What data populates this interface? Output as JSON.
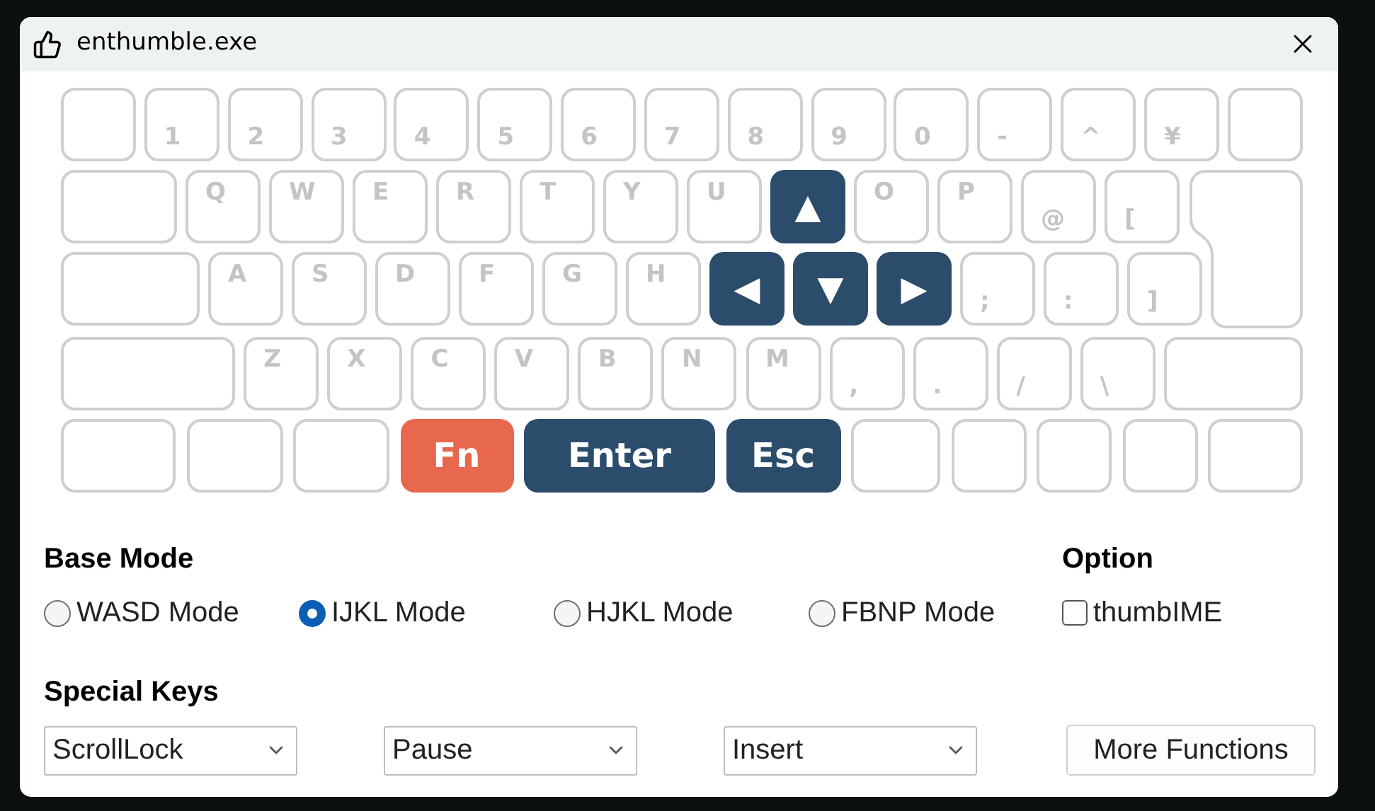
{
  "window": {
    "title": "enthumble.exe"
  },
  "keyboard": {
    "rows": [
      {
        "keys": [
          {
            "kind": "blank"
          },
          {
            "kind": "lower",
            "label": "1"
          },
          {
            "kind": "lower",
            "label": "2"
          },
          {
            "kind": "lower",
            "label": "3"
          },
          {
            "kind": "lower",
            "label": "4"
          },
          {
            "kind": "lower",
            "label": "5"
          },
          {
            "kind": "lower",
            "label": "6"
          },
          {
            "kind": "lower",
            "label": "7"
          },
          {
            "kind": "lower",
            "label": "8"
          },
          {
            "kind": "lower",
            "label": "9"
          },
          {
            "kind": "lower",
            "label": "0"
          },
          {
            "kind": "lower",
            "label": "-"
          },
          {
            "kind": "lower",
            "label": "^"
          },
          {
            "kind": "lower",
            "label": "¥"
          },
          {
            "kind": "blank"
          }
        ]
      },
      {
        "keys": [
          {
            "kind": "blank"
          },
          {
            "kind": "upper",
            "label": "Q"
          },
          {
            "kind": "upper",
            "label": "W"
          },
          {
            "kind": "upper",
            "label": "E"
          },
          {
            "kind": "upper",
            "label": "R"
          },
          {
            "kind": "upper",
            "label": "T"
          },
          {
            "kind": "upper",
            "label": "Y"
          },
          {
            "kind": "upper",
            "label": "U"
          },
          {
            "kind": "mapped",
            "label": "▲",
            "color": "#2c4c6c"
          },
          {
            "kind": "upper",
            "label": "O"
          },
          {
            "kind": "upper",
            "label": "P"
          },
          {
            "kind": "lower",
            "label": "@"
          },
          {
            "kind": "lower",
            "label": "["
          }
        ]
      },
      {
        "keys": [
          {
            "kind": "blank"
          },
          {
            "kind": "upper",
            "label": "A"
          },
          {
            "kind": "upper",
            "label": "S"
          },
          {
            "kind": "upper",
            "label": "D"
          },
          {
            "kind": "upper",
            "label": "F"
          },
          {
            "kind": "upper",
            "label": "G"
          },
          {
            "kind": "upper",
            "label": "H"
          },
          {
            "kind": "mapped",
            "label": "◀",
            "color": "#2c4c6c"
          },
          {
            "kind": "mapped",
            "label": "▼",
            "color": "#2c4c6c"
          },
          {
            "kind": "mapped",
            "label": "▶",
            "color": "#2c4c6c"
          },
          {
            "kind": "lower",
            "label": ";"
          },
          {
            "kind": "lower",
            "label": ":"
          },
          {
            "kind": "lower",
            "label": "]"
          }
        ]
      },
      {
        "keys": [
          {
            "kind": "blank"
          },
          {
            "kind": "upper",
            "label": "Z"
          },
          {
            "kind": "upper",
            "label": "X"
          },
          {
            "kind": "upper",
            "label": "C"
          },
          {
            "kind": "upper",
            "label": "V"
          },
          {
            "kind": "upper",
            "label": "B"
          },
          {
            "kind": "upper",
            "label": "N"
          },
          {
            "kind": "upper",
            "label": "M"
          },
          {
            "kind": "lower",
            "label": ","
          },
          {
            "kind": "lower",
            "label": "."
          },
          {
            "kind": "lower",
            "label": "/"
          },
          {
            "kind": "lower",
            "label": "\\"
          },
          {
            "kind": "blank"
          }
        ]
      },
      {
        "keys": [
          {
            "kind": "blank"
          },
          {
            "kind": "blank"
          },
          {
            "kind": "blank"
          },
          {
            "kind": "mapped",
            "label": "Fn",
            "color": "#e8674f"
          },
          {
            "kind": "mapped",
            "label": "Enter",
            "color": "#2c4c6c"
          },
          {
            "kind": "mapped",
            "label": "Esc",
            "color": "#2c4c6c"
          },
          {
            "kind": "blank"
          },
          {
            "kind": "blank"
          },
          {
            "kind": "blank"
          },
          {
            "kind": "blank"
          },
          {
            "kind": "blank"
          }
        ]
      }
    ]
  },
  "base_mode": {
    "heading": "Base Mode",
    "options": [
      {
        "label": "WASD Mode",
        "selected": false
      },
      {
        "label": "IJKL Mode",
        "selected": true
      },
      {
        "label": "HJKL Mode",
        "selected": false
      },
      {
        "label": "FBNP Mode",
        "selected": false
      }
    ]
  },
  "option": {
    "heading": "Option",
    "checkbox": {
      "label": "thumbIME",
      "checked": false
    }
  },
  "special_keys": {
    "heading": "Special Keys",
    "selects": [
      "ScrollLock",
      "Pause",
      "Insert"
    ]
  },
  "more_button": "More Functions"
}
